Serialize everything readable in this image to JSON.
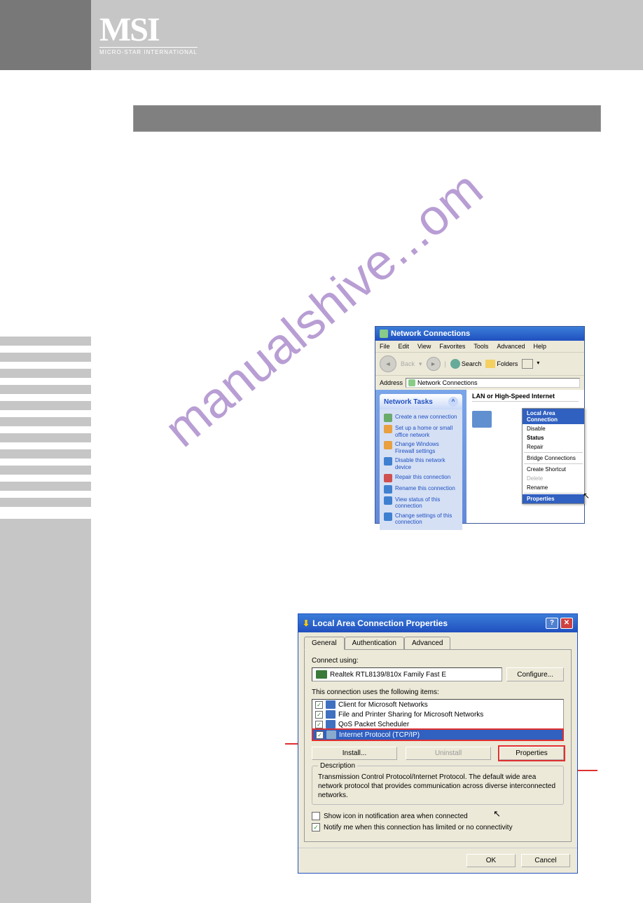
{
  "logo": {
    "main": "MSI",
    "sub": "MICRO-STAR INTERNATIONAL"
  },
  "watermark": "manualshive...om",
  "screenshot1": {
    "title": "Network Connections",
    "menu": [
      "File",
      "Edit",
      "View",
      "Favorites",
      "Tools",
      "Advanced",
      "Help"
    ],
    "toolbar": {
      "back": "Back",
      "search": "Search",
      "folders": "Folders"
    },
    "address_label": "Address",
    "address_value": "Network Connections",
    "task_panel_title": "Network Tasks",
    "tasks": [
      "Create a new connection",
      "Set up a home or small office network",
      "Change Windows Firewall settings",
      "Disable this network device",
      "Repair this connection",
      "Rename this connection",
      "View status of this connection",
      "Change settings of this connection"
    ],
    "section_head": "LAN or High-Speed Internet",
    "context_menu": {
      "header": "Local Area Connection",
      "items": [
        "Disable",
        "Status",
        "Repair",
        "Bridge Connections",
        "Create Shortcut",
        "Delete",
        "Rename",
        "Properties"
      ]
    }
  },
  "screenshot2": {
    "title": "Local Area Connection Properties",
    "tabs": [
      "General",
      "Authentication",
      "Advanced"
    ],
    "connect_using_label": "Connect using:",
    "adapter": "Realtek RTL8139/810x Family Fast E",
    "configure_btn": "Configure...",
    "items_label": "This connection uses the following items:",
    "items": [
      "Client for Microsoft Networks",
      "File and Printer Sharing for Microsoft Networks",
      "QoS Packet Scheduler",
      "Internet Protocol (TCP/IP)"
    ],
    "install_btn": "Install...",
    "uninstall_btn": "Uninstall",
    "properties_btn": "Properties",
    "desc_legend": "Description",
    "desc_text": "Transmission Control Protocol/Internet Protocol. The default wide area network protocol that provides communication across diverse interconnected networks.",
    "notify1": "Show icon in notification area when connected",
    "notify2": "Notify me when this connection has limited or no connectivity",
    "ok": "OK",
    "cancel": "Cancel"
  }
}
